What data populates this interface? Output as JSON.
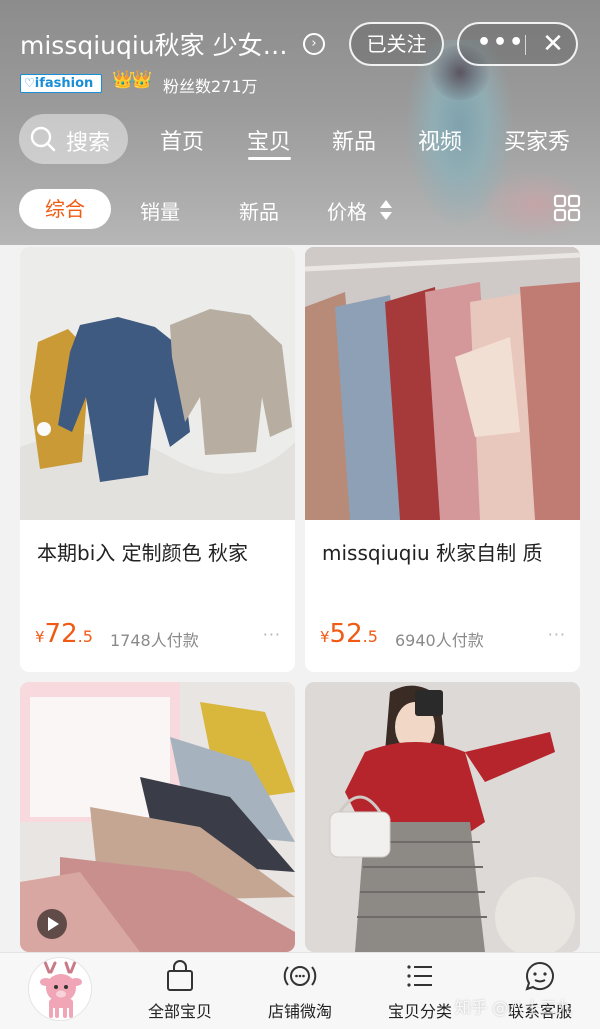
{
  "header": {
    "shop_name": "missqiuqiu秋家 少女…",
    "follow_label": "已关注",
    "more_label": "•••",
    "close_label": "✕",
    "badge_text": "ifashion",
    "crowns": "👑👑",
    "fans_text": "粉丝数271万"
  },
  "nav": {
    "search_label": "搜索",
    "tabs": [
      {
        "label": "首页"
      },
      {
        "label": "宝贝"
      },
      {
        "label": "新品"
      },
      {
        "label": "视频"
      },
      {
        "label": "买家秀"
      }
    ],
    "active_tab": "宝贝"
  },
  "filters": {
    "items": [
      {
        "label": "综合"
      },
      {
        "label": "销量"
      },
      {
        "label": "新品"
      },
      {
        "label": "价格"
      }
    ],
    "active": "综合"
  },
  "products": [
    {
      "title": "本期bi入 定制颜色 秋家",
      "price_symbol": "¥",
      "price_int": "72",
      "price_dec": ".5",
      "sold": "1748人付款",
      "more": "···"
    },
    {
      "title": "missqiuqiu 秋家自制 质",
      "price_symbol": "¥",
      "price_int": "52",
      "price_dec": ".5",
      "sold": "6940人付款",
      "more": "···"
    }
  ],
  "bottom_nav": {
    "items": [
      {
        "label": "全部宝贝",
        "icon": "shopping-bag-icon"
      },
      {
        "label": "店铺微淘",
        "icon": "broadcast-icon"
      },
      {
        "label": "宝贝分类",
        "icon": "list-icon"
      },
      {
        "label": "联系客服",
        "icon": "chat-face-icon"
      }
    ]
  },
  "watermark": "知乎 @八十三九",
  "colors": {
    "accent": "#f05a14",
    "header_bg": "#9a9a9a",
    "card_bg": "#ffffff",
    "page_bg": "#f2f2f2"
  }
}
